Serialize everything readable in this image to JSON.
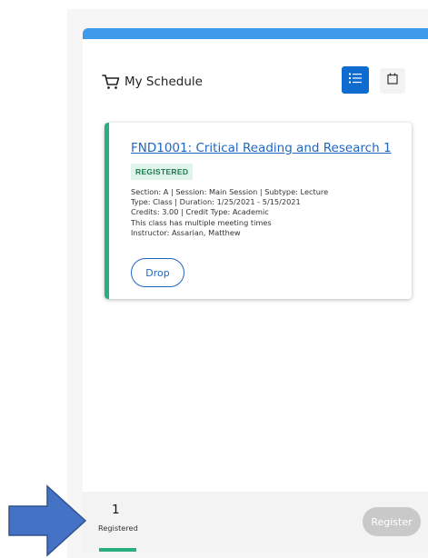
{
  "schedule": {
    "title": "My Schedule",
    "icons": {
      "header": "cart-icon",
      "list_view": "list-icon",
      "calendar_view": "calendar-icon"
    }
  },
  "course": {
    "title": "FND1001: Critical Reading and Research 1",
    "status": "REGISTERED",
    "details": [
      "Section: A | Session: Main Session | Subtype: Lecture",
      "Type: Class | Duration: 1/25/2021 - 5/15/2021",
      "Credits: 3.00 | Credit Type: Academic",
      "This class has multiple meeting times",
      "Instructor: Assarian, Matthew"
    ],
    "drop_label": "Drop"
  },
  "footer": {
    "count": "1",
    "count_label": "Registered",
    "register_label": "Register"
  },
  "colors": {
    "top_bar": "#3d9be9",
    "accent_green": "#27b07e",
    "primary_blue": "#0e6bcf",
    "link_blue": "#1f66c4",
    "arrow_fill": "#4472c4",
    "arrow_stroke": "#2f528f",
    "disabled_gray": "#c9c9c9"
  }
}
